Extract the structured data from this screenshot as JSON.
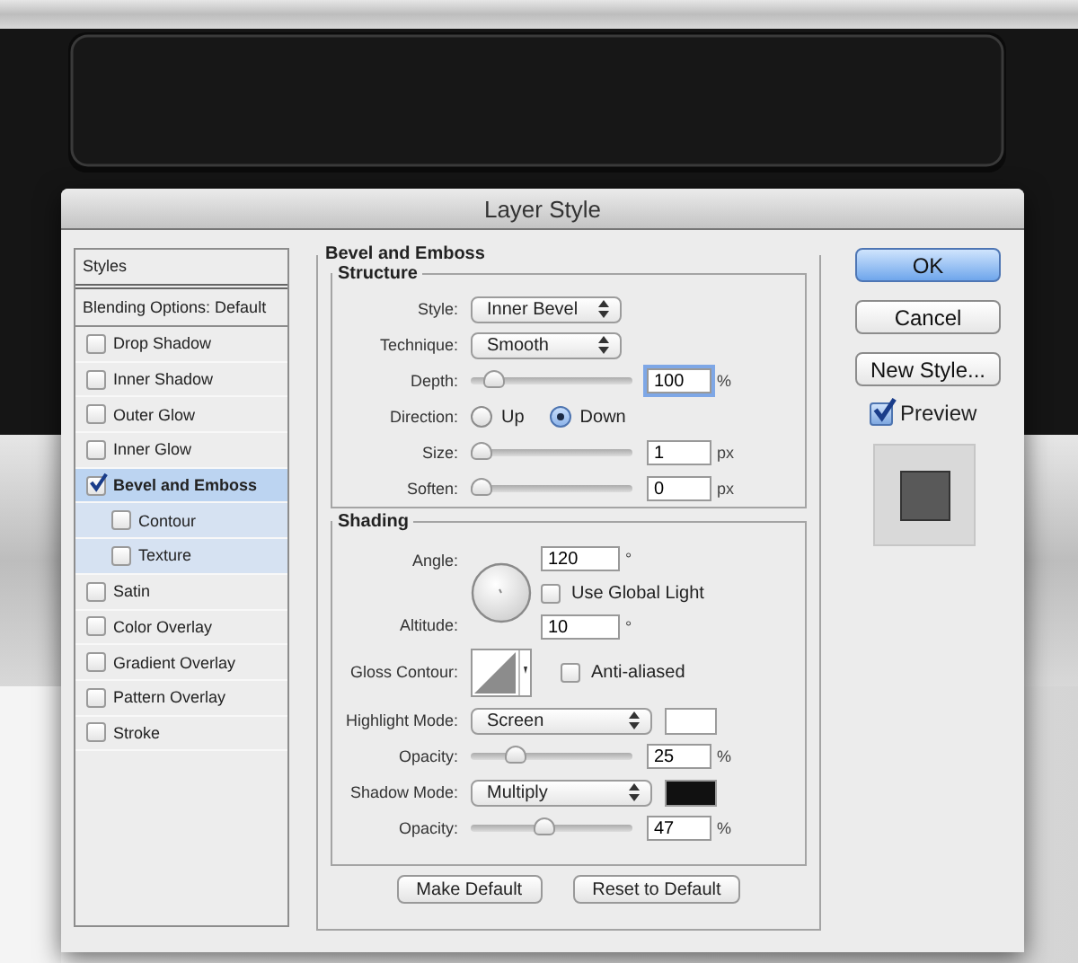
{
  "window": {
    "title": "Layer Style"
  },
  "sidebar": {
    "header": "Styles",
    "blending": "Blending Options: Default",
    "items": [
      {
        "label": "Drop Shadow",
        "checked": false,
        "selected": false
      },
      {
        "label": "Inner Shadow",
        "checked": false,
        "selected": false
      },
      {
        "label": "Outer Glow",
        "checked": false,
        "selected": false
      },
      {
        "label": "Inner Glow",
        "checked": false,
        "selected": false
      },
      {
        "label": "Bevel and Emboss",
        "checked": true,
        "selected": true,
        "children": [
          {
            "label": "Contour",
            "checked": false,
            "selected": false
          },
          {
            "label": "Texture",
            "checked": false,
            "selected": false
          }
        ]
      },
      {
        "label": "Satin",
        "checked": false,
        "selected": false
      },
      {
        "label": "Color Overlay",
        "checked": false,
        "selected": false
      },
      {
        "label": "Gradient Overlay",
        "checked": false,
        "selected": false
      },
      {
        "label": "Pattern Overlay",
        "checked": false,
        "selected": false
      },
      {
        "label": "Stroke",
        "checked": false,
        "selected": false
      }
    ]
  },
  "panel": {
    "title": "Bevel and Emboss",
    "structure": {
      "title": "Structure",
      "rows": [
        {
          "kind": "select",
          "label": "Style:",
          "value": "Inner Bevel"
        },
        {
          "kind": "select",
          "label": "Technique:",
          "value": "Smooth"
        },
        {
          "kind": "slider",
          "label": "Depth:",
          "level": 0.1,
          "value": "100",
          "unit": "%",
          "focused": true
        },
        {
          "kind": "radio",
          "label": "Direction:",
          "options": [
            {
              "label": "Up",
              "selected": false
            },
            {
              "label": "Down",
              "selected": true
            }
          ]
        },
        {
          "kind": "slider",
          "label": "Size:",
          "level": 0,
          "value": "1",
          "unit": "px",
          "focused": false
        },
        {
          "kind": "slider",
          "label": "Soften:",
          "level": 0,
          "value": "0",
          "unit": "px",
          "focused": false
        }
      ]
    },
    "shading": {
      "title": "Shading",
      "angle": {
        "label": "Angle:",
        "value": "120",
        "unit": "°"
      },
      "global_light": {
        "label": "Use Global Light",
        "checked": false
      },
      "altitude": {
        "label": "Altitude:",
        "value": "10",
        "unit": "°"
      },
      "gloss_contour": {
        "label": "Gloss Contour:"
      },
      "anti_aliased": {
        "label": "Anti-aliased",
        "checked": false
      },
      "rows": [
        {
          "kind": "select",
          "label": "Highlight Mode:",
          "value": "Screen",
          "color": "#ffffff"
        },
        {
          "kind": "slider",
          "label": "Opacity:",
          "level": 0.25,
          "value": "25",
          "unit": "%",
          "focused": false
        },
        {
          "kind": "select",
          "label": "Shadow Mode:",
          "value": "Multiply",
          "color": "#111111"
        },
        {
          "kind": "slider",
          "label": "Opacity:",
          "level": 0.47,
          "value": "47",
          "unit": "%",
          "focused": false
        }
      ]
    },
    "buttons": [
      "Make Default",
      "Reset to Default"
    ]
  },
  "actions": [
    {
      "label": "OK",
      "default": true
    },
    {
      "label": "Cancel",
      "default": false
    },
    {
      "label": "New Style...",
      "default": false
    }
  ],
  "preview": {
    "label": "Preview",
    "checked": true
  }
}
